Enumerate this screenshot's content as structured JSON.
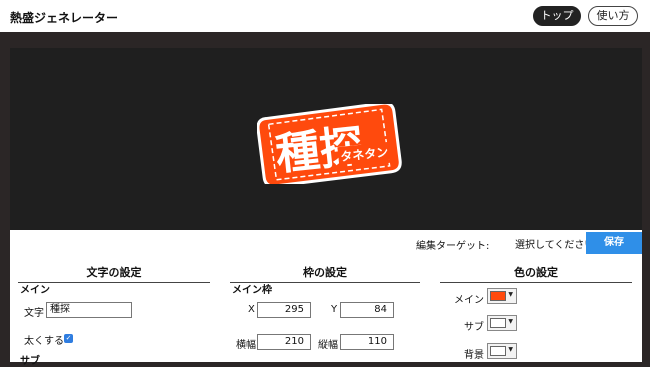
{
  "app": {
    "title": "熱盛ジェネレーター"
  },
  "nav": {
    "top": "トップ",
    "usage": "使い方"
  },
  "stamp": {
    "main_text": "種探",
    "sub_text": "タネタン"
  },
  "toolbar": {
    "target_label": "編集ターゲット:",
    "target_value": "選択してください",
    "save_label": "保存"
  },
  "text_settings": {
    "heading": "文字の設定",
    "main_label": "メイン",
    "char_label": "文字",
    "char_value": "種探",
    "bold_label": "太くする",
    "bold_checked": true,
    "sub_label": "サブ"
  },
  "frame_settings": {
    "heading": "枠の設定",
    "main_frame_label": "メイン枠",
    "x_label": "X",
    "x_value": "295",
    "y_label": "Y",
    "y_value": "84",
    "width_label": "横幅",
    "width_value": "210",
    "height_label": "縦幅",
    "height_value": "110"
  },
  "color_settings": {
    "heading": "色の設定",
    "main_label": "メイン",
    "main_color": "#ff4a0d",
    "sub_label": "サブ",
    "sub_color": "#ffffff",
    "bg_label": "背景",
    "bg_color": "#ffffff"
  }
}
